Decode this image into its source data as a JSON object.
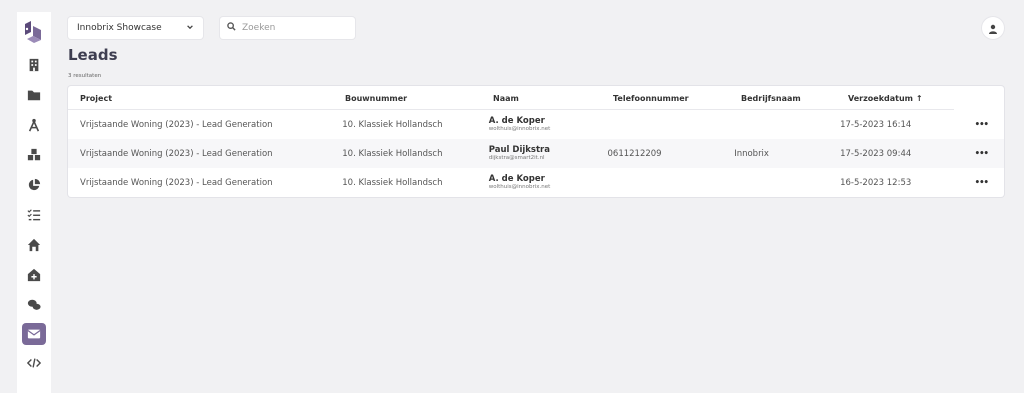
{
  "project_select": {
    "value": "Innobrix Showcase"
  },
  "search": {
    "placeholder": "Zoeken"
  },
  "page": {
    "title": "Leads",
    "results": "3 resultaten"
  },
  "table": {
    "headers": [
      "Project",
      "Bouwnummer",
      "Naam",
      "Telefoonnummer",
      "Bedrijfsnaam",
      "Verzoekdatum",
      "↑"
    ],
    "rows": [
      {
        "project": "Vrijstaande Woning (2023) - Lead Generation",
        "bouwnummer": "10. Klassiek Hollandsch",
        "name": "A. de Koper",
        "email": "wolthuis@innobrix.net",
        "phone": "",
        "company": "",
        "date": "17-5-2023 16:14",
        "menu": "•••"
      },
      {
        "project": "Vrijstaande Woning (2023) - Lead Generation",
        "bouwnummer": "10. Klassiek Hollandsch",
        "name": "Paul Dijkstra",
        "email": "dijkstra@smart2it.nl",
        "phone": "0611212209",
        "company": "Innobrix",
        "date": "17-5-2023 09:44",
        "menu": "•••"
      },
      {
        "project": "Vrijstaande Woning (2023) - Lead Generation",
        "bouwnummer": "10. Klassiek Hollandsch",
        "name": "A. de Koper",
        "email": "wolthuis@innobrix.net",
        "phone": "",
        "company": "",
        "date": "16-5-2023 12:53",
        "menu": "•••"
      }
    ]
  },
  "sidebar": {
    "items": [
      "building-icon",
      "folder-icon",
      "compass-icon",
      "cubes-icon",
      "pie-chart-icon",
      "checklist-icon",
      "home-icon",
      "house-plus-icon",
      "chat-icon",
      "mail-icon",
      "code-icon"
    ],
    "active": "mail-icon"
  },
  "colors": {
    "accent": "#7a6a98",
    "logo": "#5b4a7a",
    "background": "#f1f1f3"
  }
}
